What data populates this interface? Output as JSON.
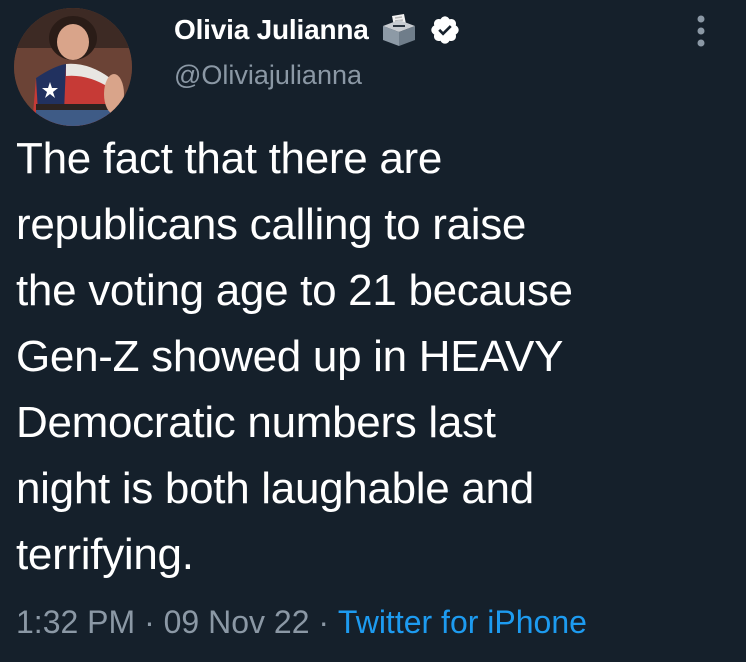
{
  "author": {
    "display_name": "Olivia Julianna",
    "handle": "@Oliviajulianna",
    "badges": [
      "ballot-box-icon",
      "verified-badge-icon"
    ],
    "avatar": "profile-photo"
  },
  "tweet": {
    "text": "The fact that there are\nrepublicans calling to raise\nthe voting age to 21 because\nGen-Z showed up in HEAVY\nDemocratic numbers last\nnight is both laughable and\nterrifying."
  },
  "meta": {
    "time": "1:32 PM",
    "separator": " · ",
    "date": "09 Nov 22",
    "source": "Twitter for iPhone"
  },
  "colors": {
    "background": "#15202b",
    "text": "#ffffff",
    "secondary": "#8b98a5",
    "accent": "#1d9bf0"
  },
  "icons": {
    "more": "more-vertical-icon"
  }
}
